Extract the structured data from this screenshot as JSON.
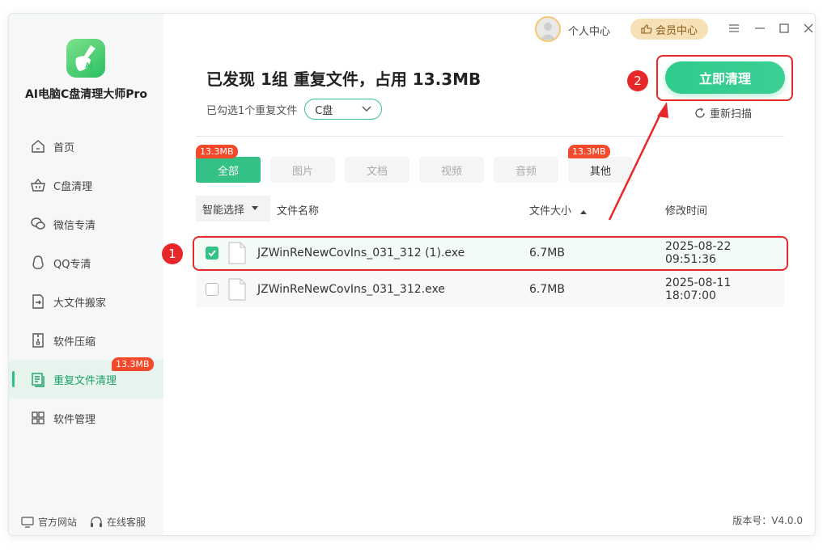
{
  "app": {
    "name": "AI电脑C盘清理大师Pro",
    "version": "版本号：V4.0.0"
  },
  "titlebar": {
    "user_center": "个人中心",
    "vip_center": "会员中心"
  },
  "sidebar": {
    "items": [
      {
        "label": "首页",
        "icon": "home-icon"
      },
      {
        "label": "C盘清理",
        "icon": "basket-icon"
      },
      {
        "label": "微信专清",
        "icon": "wechat-icon"
      },
      {
        "label": "QQ专清",
        "icon": "qq-icon"
      },
      {
        "label": "大文件搬家",
        "icon": "move-file-icon"
      },
      {
        "label": "软件压缩",
        "icon": "compress-icon"
      },
      {
        "label": "重复文件清理",
        "icon": "duplicate-file-icon",
        "badge": "13.3MB"
      },
      {
        "label": "软件管理",
        "icon": "apps-icon"
      }
    ],
    "footer": {
      "website": "官方网站",
      "support": "在线客服"
    }
  },
  "main": {
    "headline": "已发现 1组 重复文件，占用 13.3MB",
    "selected_text": "已勾选1个重复文件",
    "drive": "C盘",
    "clean_button": "立即清理",
    "rescan": "重新扫描",
    "tabs": [
      {
        "label": "全部",
        "badge": "13.3MB"
      },
      {
        "label": "图片"
      },
      {
        "label": "文档"
      },
      {
        "label": "视频"
      },
      {
        "label": "音频"
      },
      {
        "label": "其他",
        "badge": "13.3MB"
      }
    ],
    "table": {
      "smart_select": "智能选择",
      "col_name": "文件名称",
      "col_size": "文件大小",
      "col_time": "修改时间",
      "rows": [
        {
          "name": "JZWinReNewCovIns_031_312 (1).exe",
          "size": "6.7MB",
          "time": "2025-08-22 09:51:36",
          "checked": true
        },
        {
          "name": "JZWinReNewCovIns_031_312.exe",
          "size": "6.7MB",
          "time": "2025-08-11 18:07:00",
          "checked": false
        }
      ]
    }
  },
  "annotations": {
    "step1": "1",
    "step2": "2"
  },
  "colors": {
    "accent": "#33c185",
    "badge": "#f44a2c",
    "annotation": "#e8272a"
  }
}
